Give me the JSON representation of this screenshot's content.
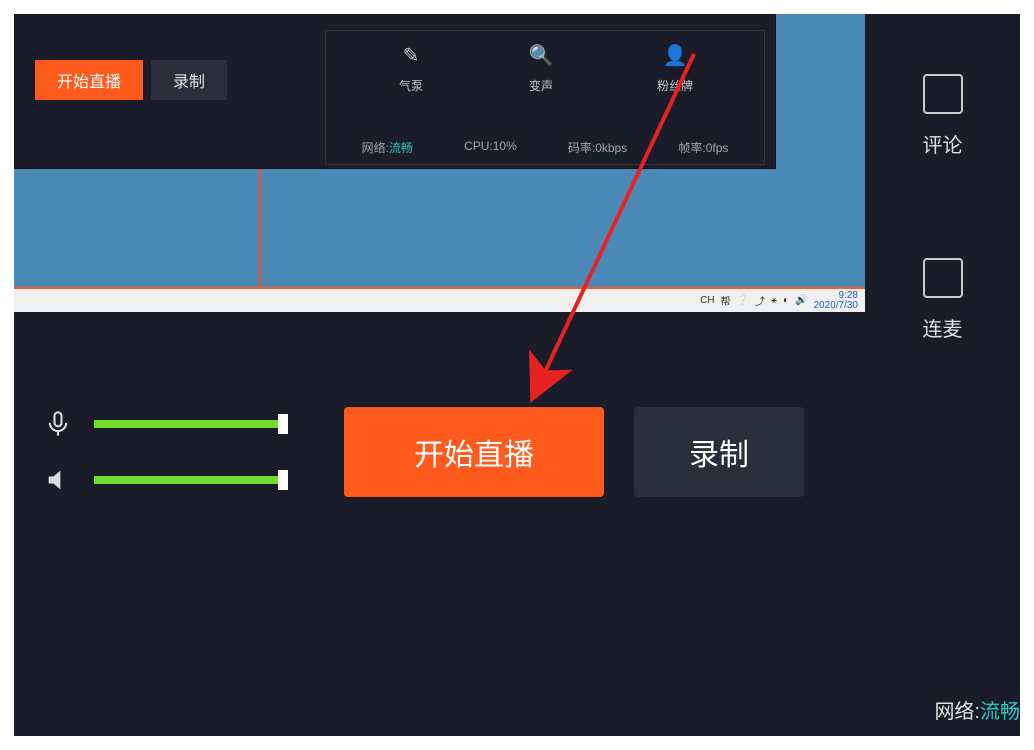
{
  "small_panel": {
    "start_live": "开始直播",
    "record": "录制",
    "tools": [
      {
        "label": "气泵",
        "icon": "✎"
      },
      {
        "label": "变声",
        "icon": "🔍"
      },
      {
        "label": "粉丝牌",
        "icon": "👤"
      }
    ],
    "stats": {
      "net_label": "网络",
      "net_value": "流畅",
      "cpu": "CPU:10%",
      "bitrate": "码率:0kbps",
      "framerate": "帧率:0fps"
    }
  },
  "taskbar": {
    "lang": "CH",
    "icons": [
      "帮",
      "❔",
      "⤴",
      "⚹",
      "◐",
      "🔊"
    ],
    "time1": "9:28",
    "time2": "2020/7/30"
  },
  "bottom": {
    "start_live": "开始直播",
    "record": "录制"
  },
  "sidebar": {
    "comments": "评论",
    "lianmai": "连麦"
  },
  "net_status": {
    "label": "网络:",
    "value": "流畅"
  }
}
